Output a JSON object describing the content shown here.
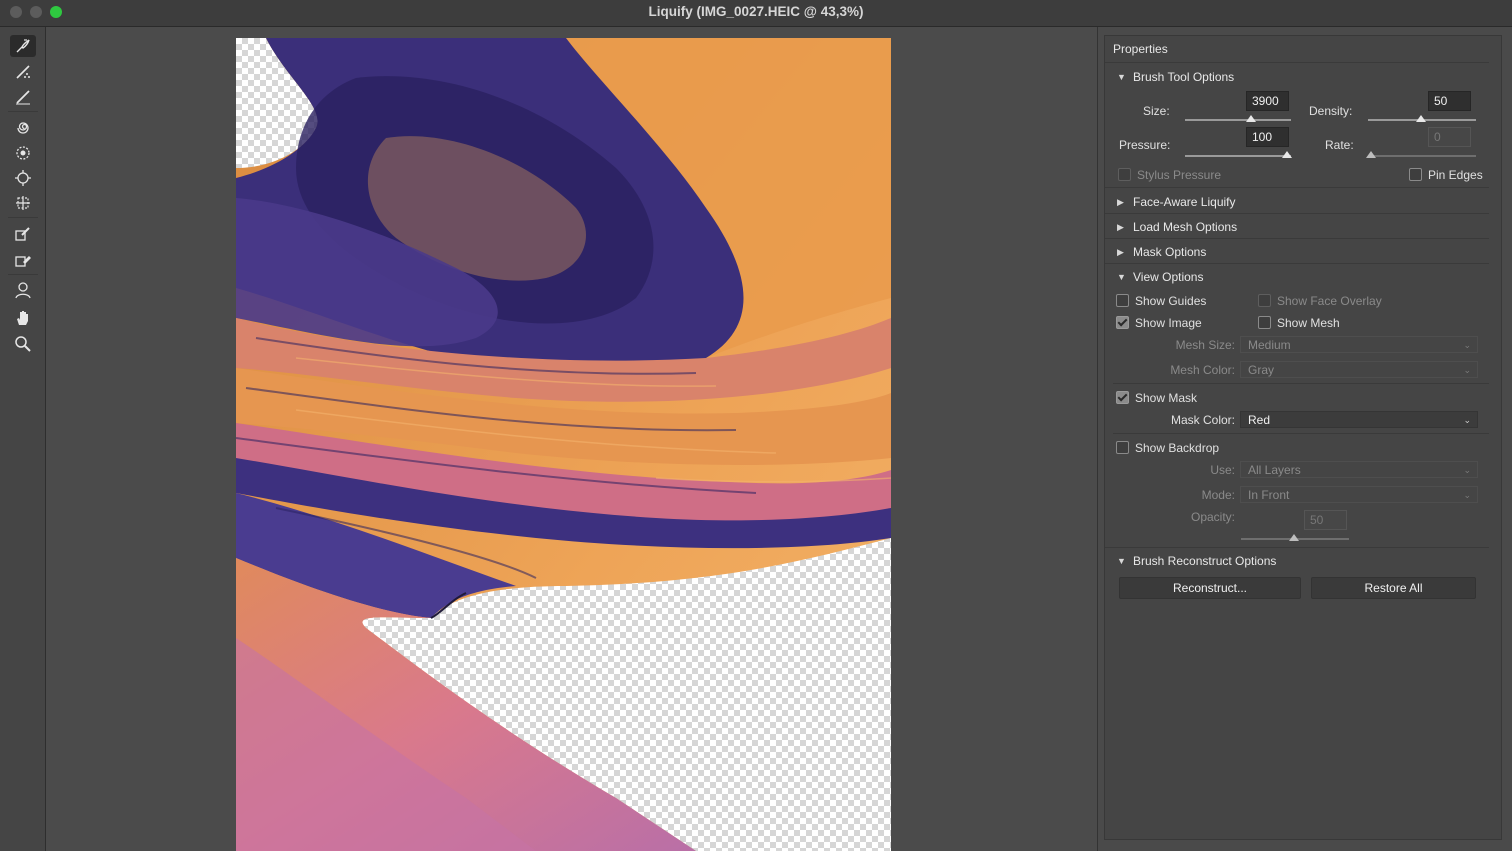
{
  "window": {
    "title": "Liquify (IMG_0027.HEIC @ 43,3%)"
  },
  "toolbar": {
    "tools": [
      "forward-warp-icon",
      "reconstruct-icon",
      "smooth-icon",
      "twirl-icon",
      "pucker-icon",
      "bloat-icon",
      "push-left-icon",
      "freeze-mask-icon",
      "thaw-mask-icon",
      "face-tool-icon",
      "hand-icon",
      "zoom-icon"
    ]
  },
  "panel": {
    "title": "Properties",
    "brush_tool_options": {
      "header": "Brush Tool Options",
      "size_label": "Size:",
      "size_value": "3900",
      "size_level": 0.6,
      "density_label": "Density:",
      "density_value": "50",
      "density_level": 0.5,
      "pressure_label": "Pressure:",
      "pressure_value": "100",
      "pressure_level": 1.0,
      "rate_label": "Rate:",
      "rate_value": "0",
      "rate_level": 0.0,
      "stylus_pressure": "Stylus Pressure",
      "pin_edges": "Pin Edges"
    },
    "face_aware": "Face-Aware Liquify",
    "load_mesh": "Load Mesh Options",
    "mask_options": "Mask Options",
    "view_options": {
      "header": "View Options",
      "show_guides": "Show Guides",
      "show_face_overlay": "Show Face Overlay",
      "show_image": "Show Image",
      "show_mesh": "Show Mesh",
      "mesh_size_label": "Mesh Size:",
      "mesh_size_value": "Medium",
      "mesh_color_label": "Mesh Color:",
      "mesh_color_value": "Gray",
      "show_mask": "Show Mask",
      "mask_color_label": "Mask Color:",
      "mask_color_value": "Red",
      "show_backdrop": "Show Backdrop",
      "use_label": "Use:",
      "use_value": "All Layers",
      "mode_label": "Mode:",
      "mode_value": "In Front",
      "opacity_label": "Opacity:",
      "opacity_value": "50",
      "opacity_level": 0.5
    },
    "reconstruct": {
      "header": "Brush Reconstruct Options",
      "reconstruct_button": "Reconstruct...",
      "restore_button": "Restore All"
    }
  },
  "colors": {
    "accent_green": "#2fc840",
    "image_orange": "#e79a4a",
    "image_purple": "#3b2f7a",
    "image_pink": "#dc7a8c"
  }
}
